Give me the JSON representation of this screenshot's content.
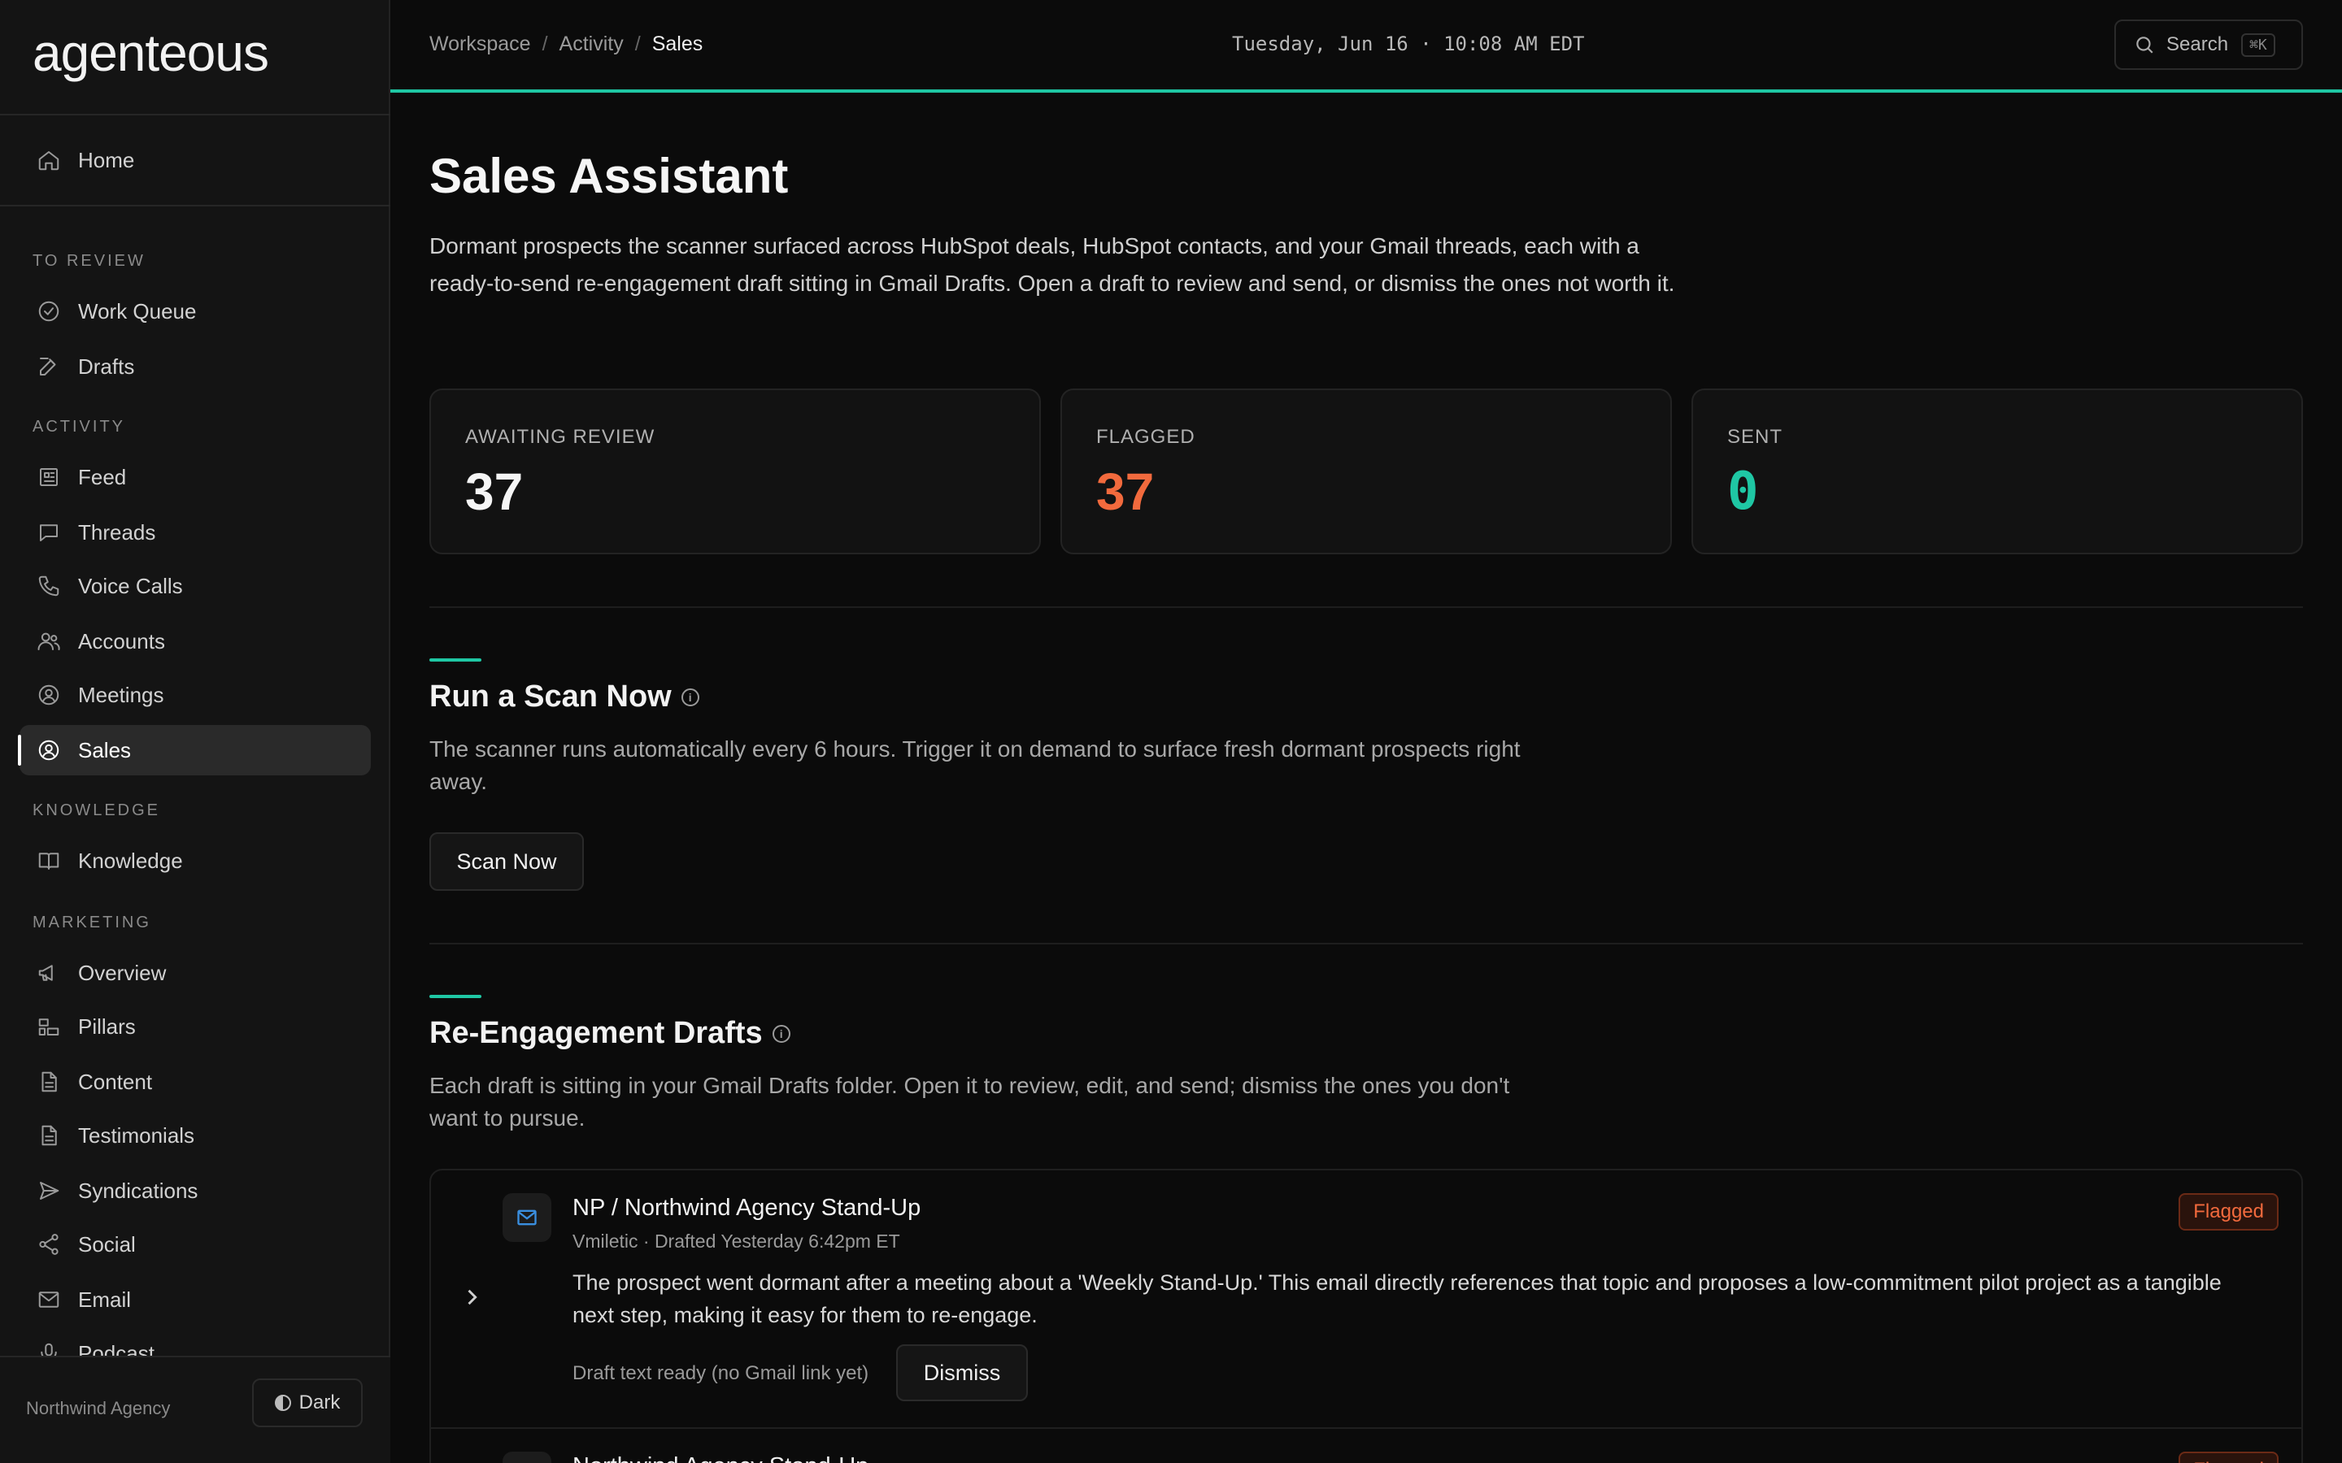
{
  "brand": {
    "logo_text": "agenteous"
  },
  "sidebar": {
    "home": "Home",
    "sections": {
      "to_review": "TO REVIEW",
      "activity": "ACTIVITY",
      "knowledge": "KNOWLEDGE",
      "marketing": "MARKETING"
    },
    "to_review_items": [
      "Work Queue",
      "Drafts"
    ],
    "activity_items": [
      "Feed",
      "Threads",
      "Voice Calls",
      "Accounts",
      "Meetings",
      "Sales"
    ],
    "knowledge_items": [
      "Knowledge"
    ],
    "marketing_items": [
      "Overview",
      "Pillars",
      "Content",
      "Testimonials",
      "Syndications",
      "Social",
      "Email",
      "Podcast"
    ],
    "active_item": "Sales",
    "footer": {
      "org_name": "Northwind Agency",
      "theme_label": "Dark"
    }
  },
  "header": {
    "breadcrumb": [
      "Workspace",
      "Activity",
      "Sales"
    ],
    "separator": "/",
    "datetime": "Tuesday, Jun 16 · 10:08 AM EDT",
    "search_label": "Search",
    "search_shortcut": "⌘K",
    "accent_color": "#1fc7a4"
  },
  "page": {
    "title": "Sales Assistant",
    "description": "Dormant prospects the scanner surfaced across HubSpot deals, HubSpot contacts, and your Gmail threads, each with a ready-to-send re-engagement draft sitting in Gmail Drafts. Open a draft to review and send, or dismiss the ones not worth it."
  },
  "stats": [
    {
      "label": "AWAITING REVIEW",
      "value": "37",
      "color": "#f5f5f5"
    },
    {
      "label": "FLAGGED",
      "value": "37",
      "color": "#f26a3d"
    },
    {
      "label": "SENT",
      "value": "0",
      "color": "#1fc7a4"
    }
  ],
  "scan": {
    "title": "Run a Scan Now",
    "description": "The scanner runs automatically every 6 hours. Trigger it on demand to surface fresh dormant prospects right away.",
    "button": "Scan Now"
  },
  "drafts": {
    "title": "Re-Engagement Drafts",
    "description": "Each draft is sitting in your Gmail Drafts folder. Open it to review, edit, and send; dismiss the ones you don't want to pursue.",
    "items": [
      {
        "title": "NP / Northwind Agency Stand-Up",
        "meta": "Vmiletic · Drafted Yesterday 6:42pm ET",
        "body": "The prospect went dormant after a meeting about a 'Weekly Stand-Up.' This email directly references that topic and proposes a low-commitment pilot project as a tangible next step, making it easy for them to re-engage.",
        "status": "Draft text ready (no Gmail link yet)",
        "dismiss": "Dismiss",
        "badge": "Flagged"
      },
      {
        "title": "Northwind Agency Stand-Up",
        "badge": "Flagged"
      }
    ]
  }
}
